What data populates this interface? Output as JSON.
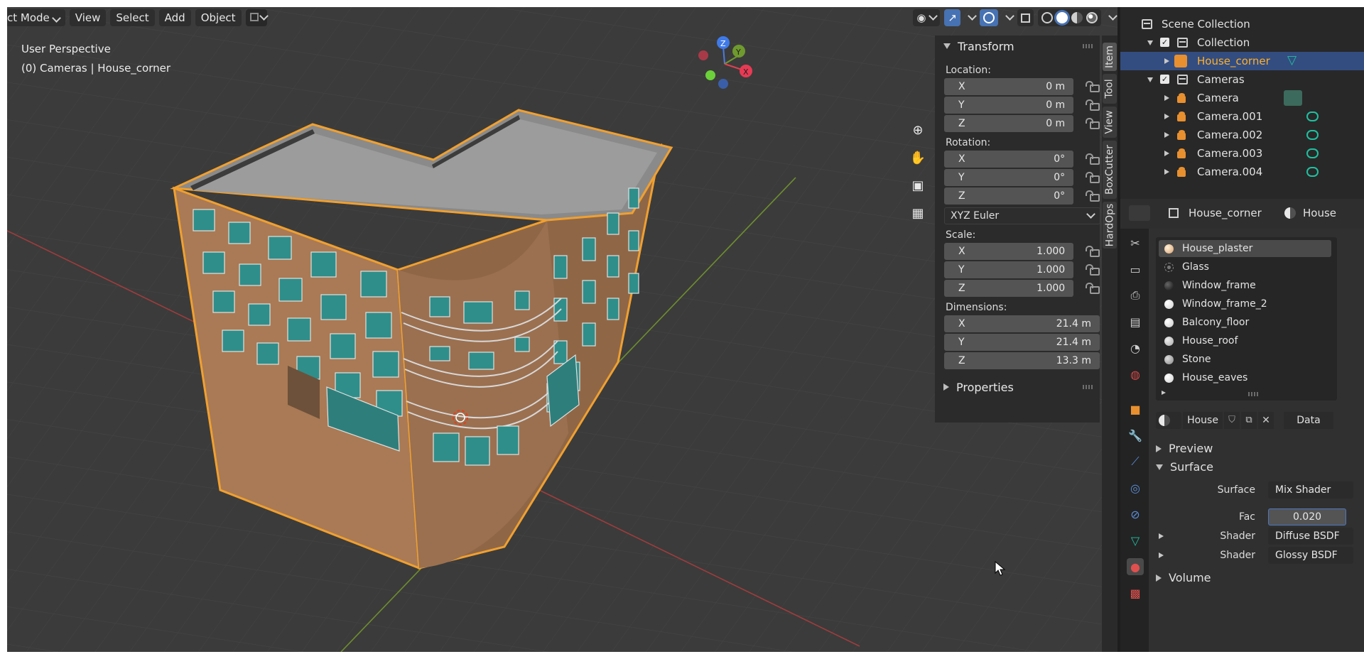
{
  "header": {
    "mode": "ct Mode",
    "menus": [
      "View",
      "Select",
      "Add",
      "Object"
    ]
  },
  "viewport": {
    "perspective": "User Perspective",
    "object_info": "(0) Cameras | House_corner",
    "gizmo": {
      "z": "Z",
      "y": "Y",
      "x": "X"
    }
  },
  "npanel": {
    "transform_title": "Transform",
    "location_label": "Location:",
    "location": [
      {
        "axis": "X",
        "value": "0 m"
      },
      {
        "axis": "Y",
        "value": "0 m"
      },
      {
        "axis": "Z",
        "value": "0 m"
      }
    ],
    "rotation_label": "Rotation:",
    "rotation": [
      {
        "axis": "X",
        "value": "0°"
      },
      {
        "axis": "Y",
        "value": "0°"
      },
      {
        "axis": "Z",
        "value": "0°"
      }
    ],
    "rotation_mode": "XYZ Euler",
    "scale_label": "Scale:",
    "scale": [
      {
        "axis": "X",
        "value": "1.000"
      },
      {
        "axis": "Y",
        "value": "1.000"
      },
      {
        "axis": "Z",
        "value": "1.000"
      }
    ],
    "dimensions_label": "Dimensions:",
    "dimensions": [
      {
        "axis": "X",
        "value": "21.4 m"
      },
      {
        "axis": "Y",
        "value": "21.4 m"
      },
      {
        "axis": "Z",
        "value": "13.3 m"
      }
    ],
    "properties_title": "Properties",
    "tabs": [
      "Item",
      "Tool",
      "View",
      "BoxCutter",
      "HardOps"
    ]
  },
  "outliner": {
    "scene_collection": "Scene Collection",
    "collection": "Collection",
    "house": "House_corner",
    "cameras_collection": "Cameras",
    "cameras": [
      "Camera",
      "Camera.001",
      "Camera.002",
      "Camera.003",
      "Camera.004"
    ]
  },
  "properties": {
    "breadcrumb_object": "House_corner",
    "breadcrumb_material": "House",
    "materials": [
      "House_plaster",
      "Glass",
      "Window_frame",
      "Window_frame_2",
      "Balcony_floor",
      "House_roof",
      "Stone",
      "House_eaves"
    ],
    "material_name": "House",
    "data_label": "Data",
    "preview_label": "Preview",
    "surface_section": "Surface",
    "surface_label": "Surface",
    "surface_value": "Mix Shader",
    "fac_label": "Fac",
    "fac_value": "0.020",
    "shader1_label": "Shader",
    "shader1_value": "Diffuse BSDF",
    "shader2_label": "Shader",
    "shader2_value": "Glossy BSDF",
    "volume_label": "Volume"
  },
  "colors": {
    "selection_outline": "#f0a030",
    "accent_blue": "#4772b3",
    "camera_orange": "#e8902f",
    "data_teal": "#20c0a0"
  }
}
